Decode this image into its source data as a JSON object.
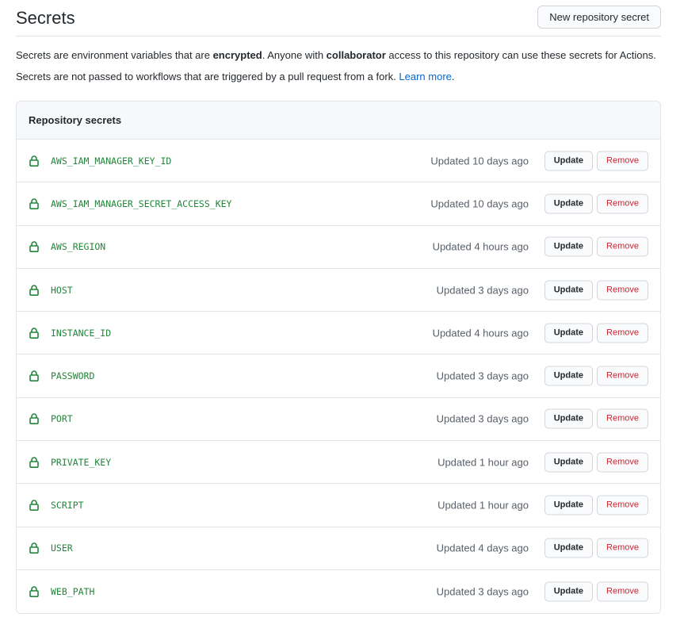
{
  "page": {
    "title": "Secrets",
    "new_secret_label": "New repository secret",
    "desc1": {
      "a": "Secrets are environment variables that are ",
      "b": "encrypted",
      "c": ". Anyone with ",
      "d": "collaborator",
      "e": " access to this repository can use these secrets for Actions."
    },
    "desc2": {
      "a": "Secrets are not passed to workflows that are triggered by a pull request from a fork. ",
      "link": "Learn more",
      "b": "."
    }
  },
  "secrets_box": {
    "title": "Repository secrets",
    "update_label": "Update",
    "remove_label": "Remove",
    "items": [
      {
        "name": "AWS_IAM_MANAGER_KEY_ID",
        "updated": "Updated 10 days ago"
      },
      {
        "name": "AWS_IAM_MANAGER_SECRET_ACCESS_KEY",
        "updated": "Updated 10 days ago"
      },
      {
        "name": "AWS_REGION",
        "updated": "Updated 4 hours ago"
      },
      {
        "name": "HOST",
        "updated": "Updated 3 days ago"
      },
      {
        "name": "INSTANCE_ID",
        "updated": "Updated 4 hours ago"
      },
      {
        "name": "PASSWORD",
        "updated": "Updated 3 days ago"
      },
      {
        "name": "PORT",
        "updated": "Updated 3 days ago"
      },
      {
        "name": "PRIVATE_KEY",
        "updated": "Updated 1 hour ago"
      },
      {
        "name": "SCRIPT",
        "updated": "Updated 1 hour ago"
      },
      {
        "name": "USER",
        "updated": "Updated 4 days ago"
      },
      {
        "name": "WEB_PATH",
        "updated": "Updated 3 days ago"
      }
    ]
  },
  "colors": {
    "secret_name": "#22863a",
    "lock_icon": "#22863a",
    "link": "#0366d6",
    "remove": "#cb2431"
  },
  "icons": {
    "row": "lock-icon"
  }
}
